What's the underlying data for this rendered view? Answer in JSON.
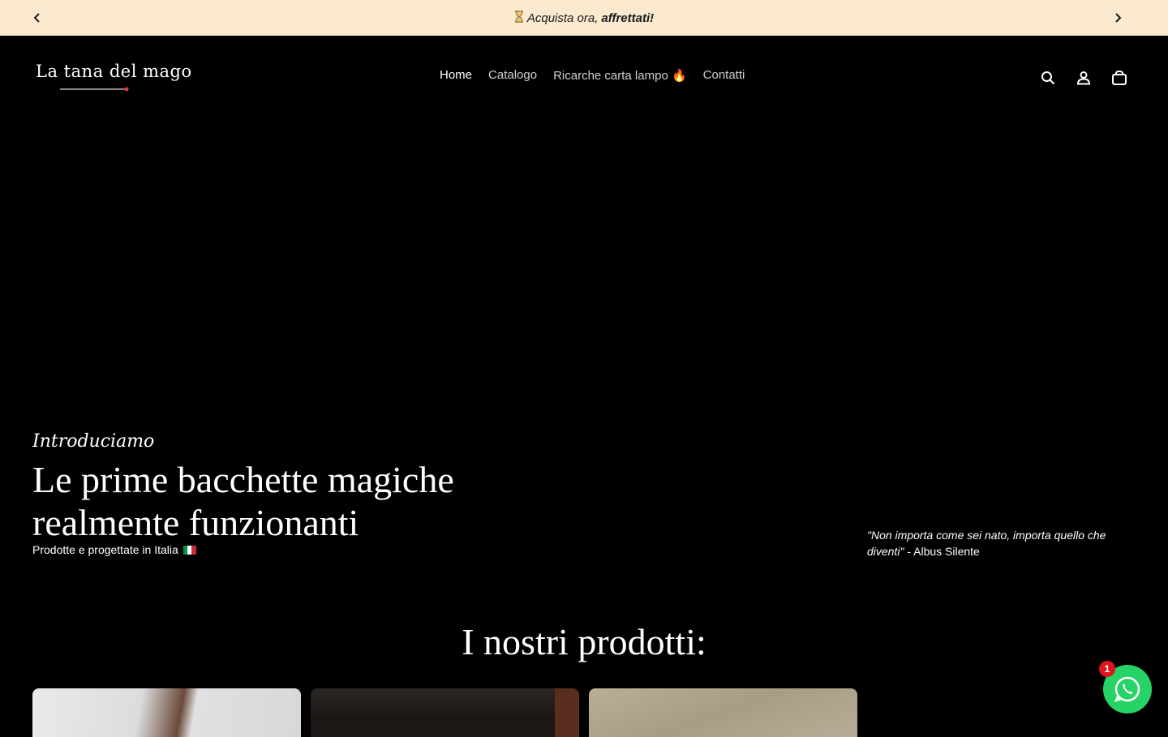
{
  "announcement": {
    "prefix": "Acquista ora,",
    "emphasis": "affrettati!",
    "prev_icon": "chevron-left-icon",
    "next_icon": "chevron-right-icon"
  },
  "header": {
    "logo_text": "La tana del mago",
    "nav": [
      {
        "label": "Home",
        "active": true
      },
      {
        "label": "Catalogo"
      },
      {
        "label": "Ricarche carta lampo 🔥"
      },
      {
        "label": "Contatti"
      }
    ],
    "icons": [
      "search-icon",
      "account-icon",
      "cart-icon"
    ]
  },
  "hero": {
    "kicker": "Introduciamo",
    "title": "Le prime bacchette magiche realmente funzionanti",
    "subtitle": "Prodotte e progettate in Italia",
    "quote_text": "\"Non importa come sei nato, importa quello che diventi\"",
    "quote_author": " - Albus Silente"
  },
  "products": {
    "title": "I nostri prodotti:"
  },
  "whatsapp": {
    "badge": "1",
    "color": "#25d366"
  },
  "colors": {
    "announcement_bg": "#fbe9d0",
    "page_bg": "#000000"
  }
}
